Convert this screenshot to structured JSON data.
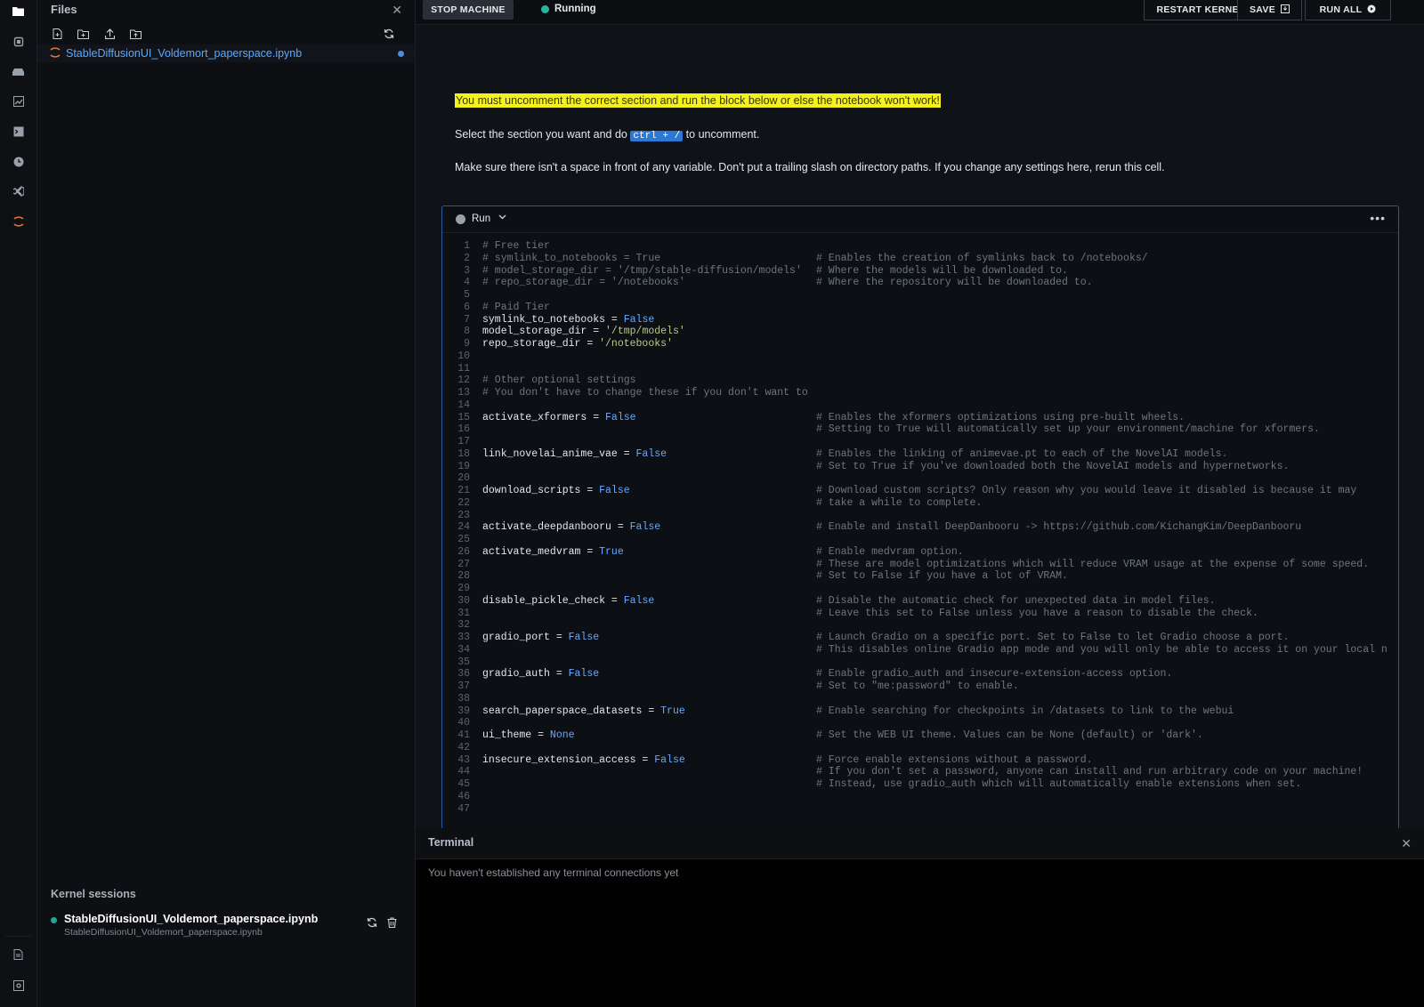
{
  "rail": {
    "icons": [
      "folder-icon",
      "chip-icon",
      "stack-icon",
      "chart-icon",
      "terminal-icon",
      "clock-icon",
      "vscode-icon",
      "jupyter-icon"
    ],
    "bottom_icons": [
      "document-icon",
      "settings-icon"
    ]
  },
  "files": {
    "title": "Files",
    "toolbar": [
      "new-file-icon",
      "new-folder-icon",
      "upload-icon",
      "folder-upload-icon",
      "refresh-icon"
    ],
    "items": [
      {
        "name": "StableDiffusionUI_Voldemort_paperspace.ipynb",
        "modified": true
      }
    ]
  },
  "kernel_sessions": {
    "title": "Kernel sessions",
    "items": [
      {
        "name": "StableDiffusionUI_Voldemort_paperspace.ipynb",
        "path": "StableDiffusionUI_Voldemort_paperspace.ipynb"
      }
    ]
  },
  "topbar": {
    "stop_label": "STOP MACHINE",
    "status": "Running",
    "restart_label": "RESTART KERNEL",
    "save_label": "SAVE",
    "run_all_label": "RUN ALL"
  },
  "markdown": {
    "warning": "You must uncomment the correct section and run the block below or else the notebook won't work!",
    "select_pre": "Select the section you want and do",
    "select_kbd": "ctrl + /",
    "select_post": "to uncomment.",
    "note": "Make sure there isn't a space in front of any variable. Don't put a trailing slash on directory paths. If you change any settings here, rerun this cell."
  },
  "cell": {
    "run_label": "Run",
    "code": [
      {
        "n": "1",
        "c": "# Free tier",
        "m": ""
      },
      {
        "n": "2",
        "c": "# symlink_to_notebooks = True",
        "m": "# Enables the creation of symlinks back to /notebooks/"
      },
      {
        "n": "3",
        "c": "# model_storage_dir = '/tmp/stable-diffusion/models'",
        "m": "# Where the models will be downloaded to."
      },
      {
        "n": "4",
        "c": "# repo_storage_dir = '/notebooks'",
        "m": "# Where the repository will be downloaded to."
      },
      {
        "n": "5",
        "c": "",
        "m": ""
      },
      {
        "n": "6",
        "c": "# Paid Tier",
        "m": ""
      },
      {
        "n": "7",
        "c": "symlink_to_notebooks = False",
        "m": ""
      },
      {
        "n": "8",
        "c": "model_storage_dir = '/tmp/models'",
        "m": ""
      },
      {
        "n": "9",
        "c": "repo_storage_dir = '/notebooks'",
        "m": ""
      },
      {
        "n": "10",
        "c": "",
        "m": ""
      },
      {
        "n": "11",
        "c": "",
        "m": ""
      },
      {
        "n": "12",
        "c": "# Other optional settings",
        "m": ""
      },
      {
        "n": "13",
        "c": "# You don't have to change these if you don't want to",
        "m": ""
      },
      {
        "n": "14",
        "c": "",
        "m": ""
      },
      {
        "n": "15",
        "c": "activate_xformers = False",
        "m": "# Enables the xformers optimizations using pre-built wheels."
      },
      {
        "n": "16",
        "c": "",
        "m": "# Setting to True will automatically set up your environment/machine for xformers."
      },
      {
        "n": "17",
        "c": "",
        "m": ""
      },
      {
        "n": "18",
        "c": "link_novelai_anime_vae = False",
        "m": "# Enables the linking of animevae.pt to each of the NovelAI models."
      },
      {
        "n": "19",
        "c": "",
        "m": "# Set to True if you've downloaded both the NovelAI models and hypernetworks."
      },
      {
        "n": "20",
        "c": "",
        "m": ""
      },
      {
        "n": "21",
        "c": "download_scripts = False",
        "m": "# Download custom scripts? Only reason why you would leave it disabled is because it may"
      },
      {
        "n": "22",
        "c": "",
        "m": "# take a while to complete."
      },
      {
        "n": "23",
        "c": "",
        "m": ""
      },
      {
        "n": "24",
        "c": "activate_deepdanbooru = False",
        "m": "# Enable and install DeepDanbooru -> https://github.com/KichangKim/DeepDanbooru"
      },
      {
        "n": "25",
        "c": "",
        "m": ""
      },
      {
        "n": "26",
        "c": "activate_medvram = True",
        "m": "# Enable medvram option."
      },
      {
        "n": "27",
        "c": "",
        "m": "# These are model optimizations which will reduce VRAM usage at the expense of some speed."
      },
      {
        "n": "28",
        "c": "",
        "m": "# Set to False if you have a lot of VRAM."
      },
      {
        "n": "29",
        "c": "",
        "m": ""
      },
      {
        "n": "30",
        "c": "disable_pickle_check = False",
        "m": "# Disable the automatic check for unexpected data in model files."
      },
      {
        "n": "31",
        "c": "",
        "m": "# Leave this set to False unless you have a reason to disable the check."
      },
      {
        "n": "32",
        "c": "",
        "m": ""
      },
      {
        "n": "33",
        "c": "gradio_port = False",
        "m": "# Launch Gradio on a specific port. Set to False to let Gradio choose a port."
      },
      {
        "n": "34",
        "c": "",
        "m": "# This disables online Gradio app mode and you will only be able to access it on your local n"
      },
      {
        "n": "35",
        "c": "",
        "m": ""
      },
      {
        "n": "36",
        "c": "gradio_auth = False",
        "m": "# Enable gradio_auth and insecure-extension-access option."
      },
      {
        "n": "37",
        "c": "",
        "m": "# Set to \"me:password\" to enable."
      },
      {
        "n": "38",
        "c": "",
        "m": ""
      },
      {
        "n": "39",
        "c": "search_paperspace_datasets = True",
        "m": "# Enable searching for checkpoints in /datasets to link to the webui"
      },
      {
        "n": "40",
        "c": "",
        "m": ""
      },
      {
        "n": "41",
        "c": "ui_theme = None",
        "m": "# Set the WEB UI theme. Values can be None (default) or 'dark'."
      },
      {
        "n": "42",
        "c": "",
        "m": ""
      },
      {
        "n": "43",
        "c": "insecure_extension_access = False",
        "m": "# Force enable extensions without a password."
      },
      {
        "n": "44",
        "c": "",
        "m": "# If you don't set a password, anyone can install and run arbitrary code on your machine!"
      },
      {
        "n": "45",
        "c": "",
        "m": "# Instead, use gradio_auth which will automatically enable extensions when set."
      },
      {
        "n": "46",
        "c": "",
        "m": ""
      },
      {
        "n": "47",
        "c": "",
        "m": ""
      }
    ]
  },
  "terminal": {
    "title": "Terminal",
    "message": "You haven't established any terminal connections yet"
  }
}
